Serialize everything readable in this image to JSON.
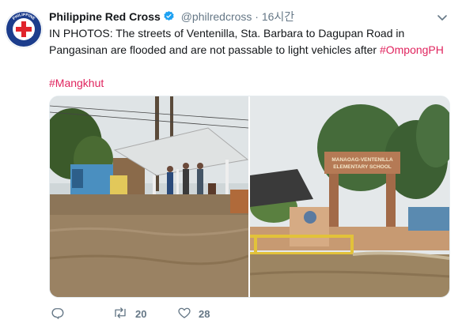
{
  "avatar": {
    "ring_text": "PHILIPPINE RED CROSS",
    "colors": {
      "ring": "#1c3d8c",
      "cross": "#e0242c"
    }
  },
  "header": {
    "name": "Philippine Red Cross",
    "handle": "@philredcross",
    "separator": "·",
    "time": "16시간"
  },
  "tweet": {
    "line1": "IN PHOTOS: The streets of Ventenilla, Sta. Barbara to Dagupan Road in",
    "line2_text": "Pangasinan are flooded and are not passable to light vehicles after ",
    "hashtag1": "#OmpongPH",
    "hashtag2": "#Mangkhut"
  },
  "media": {
    "photo_left_sign": "",
    "photo_right_sign": "MANAOAG-VENTENILLA ELEMENTARY SCHOOL"
  },
  "actions": {
    "reply_icon": "reply-icon",
    "retweet_icon": "retweet-icon",
    "like_icon": "heart-icon",
    "retweet_count": "20",
    "like_count": "28"
  },
  "colors": {
    "hashtag": "#e0245e",
    "muted": "#657786",
    "verified": "#1da1f2"
  }
}
